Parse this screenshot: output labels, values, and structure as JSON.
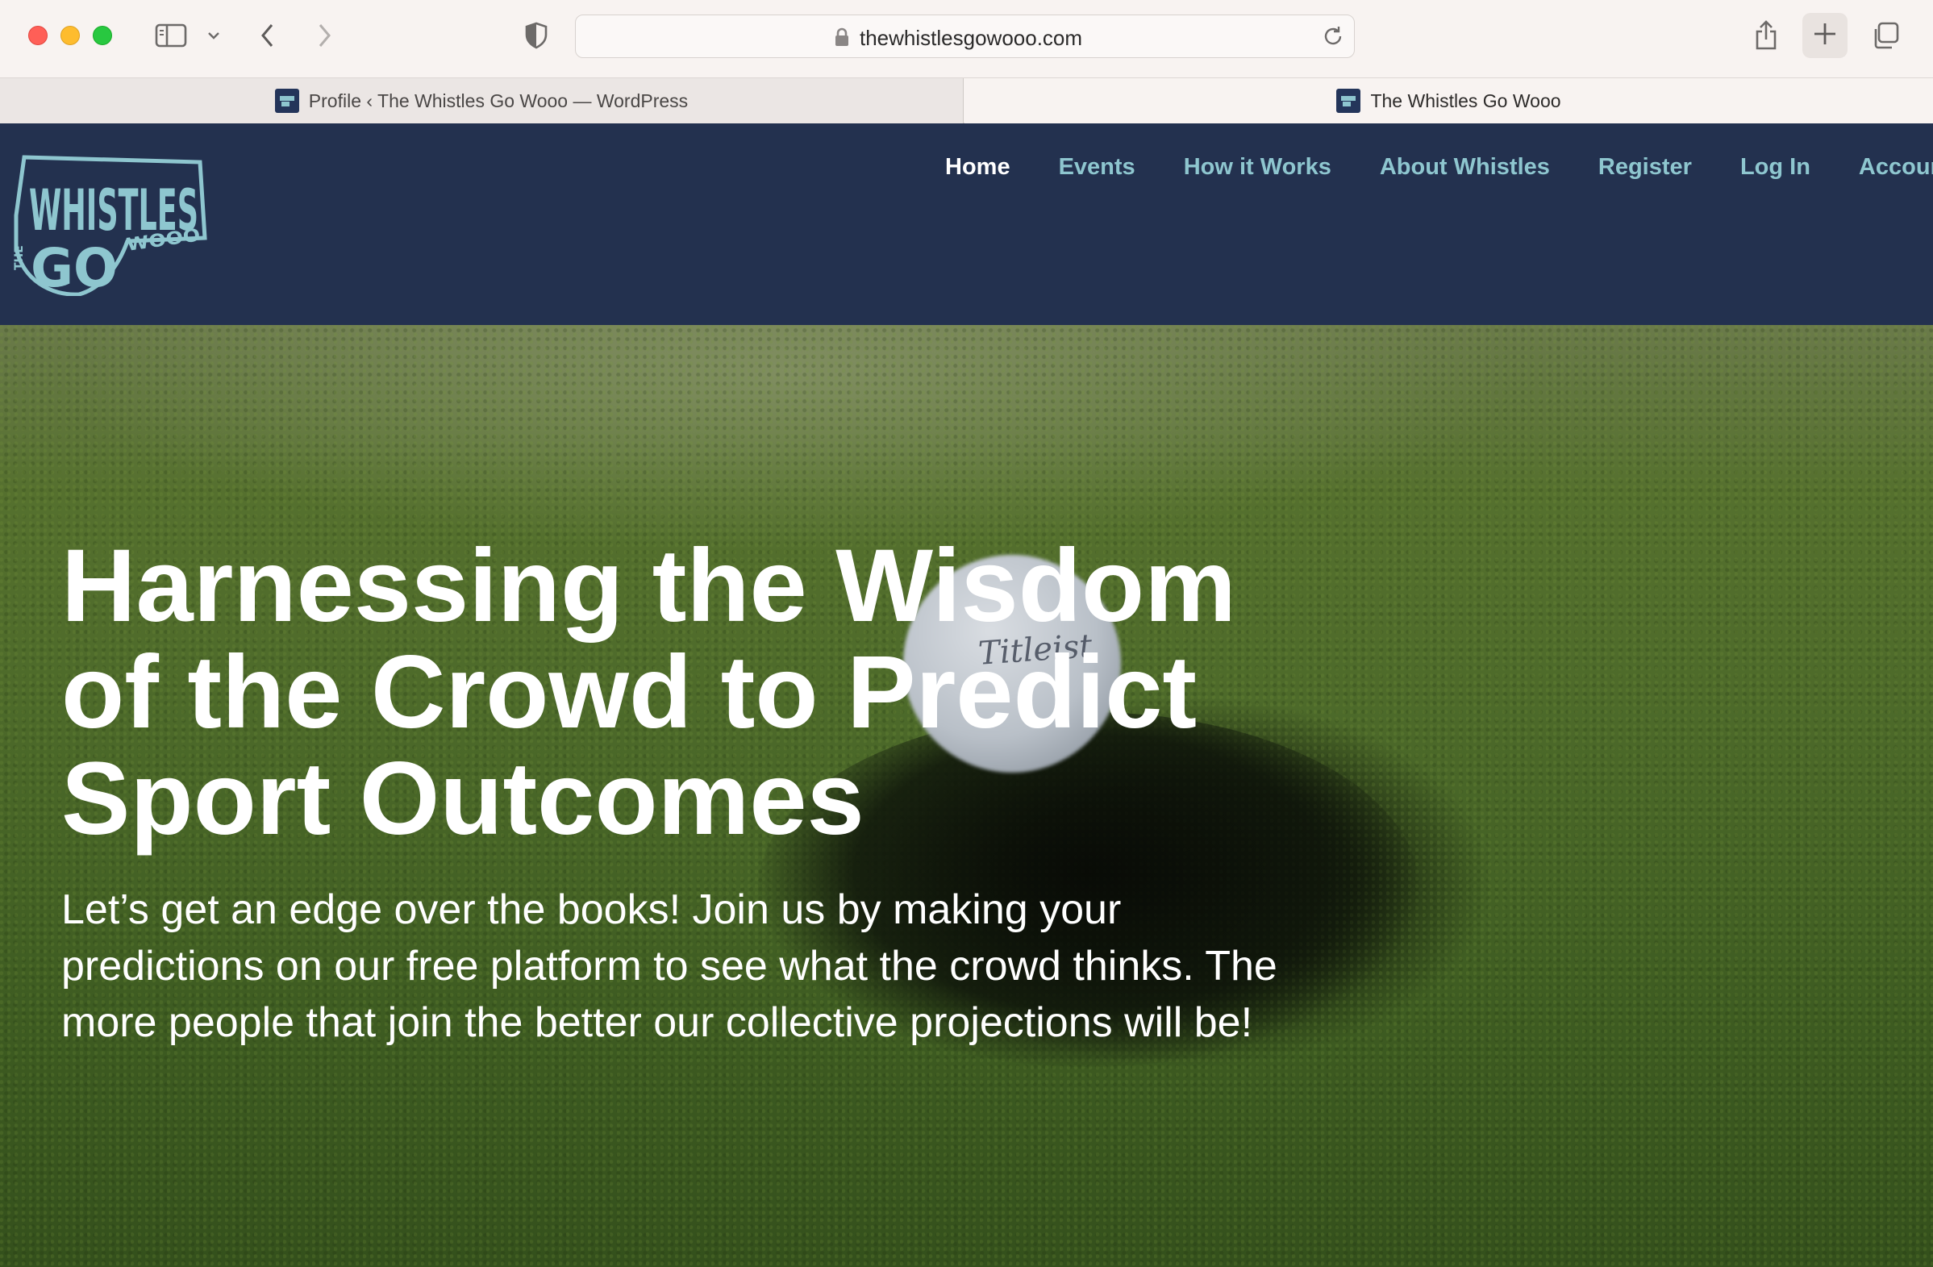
{
  "browser": {
    "url": "thewhistlesgowooo.com",
    "tabs": [
      {
        "title": "Profile ‹ The Whistles Go Wooo — WordPress",
        "active": false
      },
      {
        "title": "The Whistles Go Wooo",
        "active": true
      }
    ],
    "icons": {
      "sidebar": "sidebar-icon",
      "chevron": "chevron-down-icon",
      "back": "back-arrow-icon",
      "forward": "forward-arrow-icon",
      "privacy": "shield-icon",
      "lock": "lock-icon",
      "reload": "reload-icon",
      "share": "share-icon",
      "new_tab": "plus-icon",
      "tab_overview": "tabs-overview-icon"
    }
  },
  "site": {
    "logo": {
      "word_top": "WHISTLES",
      "word_bottom": "GO",
      "word_small_left": "THE",
      "word_small_right": "WOOO",
      "color": "#8ec6cf"
    },
    "nav": [
      {
        "label": "Home",
        "current": true
      },
      {
        "label": "Events",
        "current": false
      },
      {
        "label": "How it Works",
        "current": false
      },
      {
        "label": "About Whistles",
        "current": false
      },
      {
        "label": "Register",
        "current": false
      },
      {
        "label": "Log In",
        "current": false
      },
      {
        "label": "Account",
        "current": false
      }
    ],
    "colors": {
      "header_bg": "#23314f",
      "nav_link": "#8ec6cf",
      "nav_current": "#ffffff"
    }
  },
  "hero": {
    "heading": "Harnessing the Wisdom of the Crowd to Predict Sport Outcomes",
    "body": "Let’s get an edge over the books! Join us by making your predictions on our free platform to see what the crowd thinks. The more people that join the better our collective projections will be!",
    "ball_brand": "Titleist"
  }
}
